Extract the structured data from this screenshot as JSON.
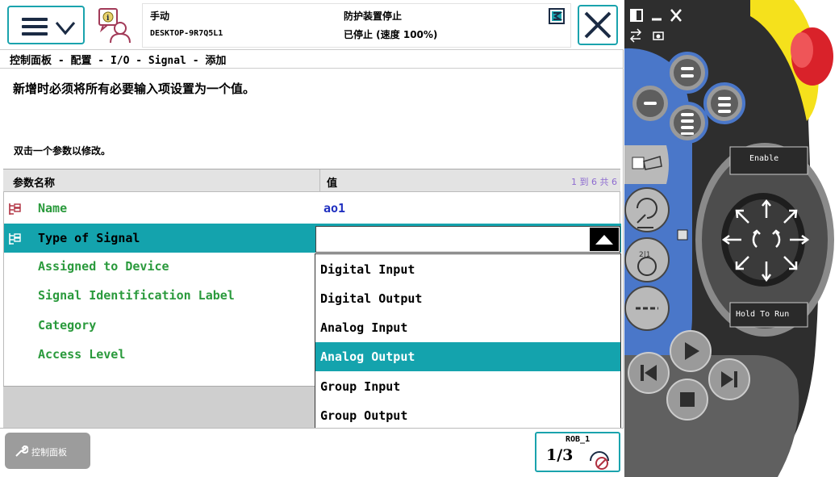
{
  "status": {
    "mode": "手动",
    "host": "DESKTOP-9R7Q5L1",
    "guard_state": "防护装置停止",
    "run_state": "已停止 (速度 100%)"
  },
  "breadcrumb": "控制面板 - 配置 - I/O - Signal - 添加",
  "instruction": "新增时必须将所有必要输入项设置为一个值。",
  "hint": "双击一个参数以修改。",
  "table": {
    "header_name": "参数名称",
    "header_value": "值",
    "page_count": "1 到 6 共 6",
    "rows": [
      {
        "name": "Name",
        "value": "ao1"
      },
      {
        "name": "Type of Signal",
        "value": ""
      },
      {
        "name": "Assigned to Device",
        "value": ""
      },
      {
        "name": "Signal Identification Label",
        "value": ""
      },
      {
        "name": "Category",
        "value": ""
      },
      {
        "name": "Access Level",
        "value": ""
      }
    ]
  },
  "dropdown": {
    "options": [
      "Digital Input",
      "Digital Output",
      "Analog Input",
      "Analog Output",
      "Group Input",
      "Group Output"
    ],
    "highlighted": "Analog Output"
  },
  "bottom": {
    "control_panel_label": "控制面板",
    "robot": "ROB_1",
    "task_fraction": "1/3"
  },
  "hardware": {
    "enable_label": "Enable",
    "hold_label": "Hold To Run"
  },
  "colors": {
    "accent": "#14a3ad",
    "param_name": "#2a9a3c",
    "value_text": "#2030c0",
    "pendant_body": "#2e2e2e",
    "pendant_blue": "#4a77c9",
    "emergency": "#d9222a",
    "guard_yellow": "#f5e11c"
  }
}
